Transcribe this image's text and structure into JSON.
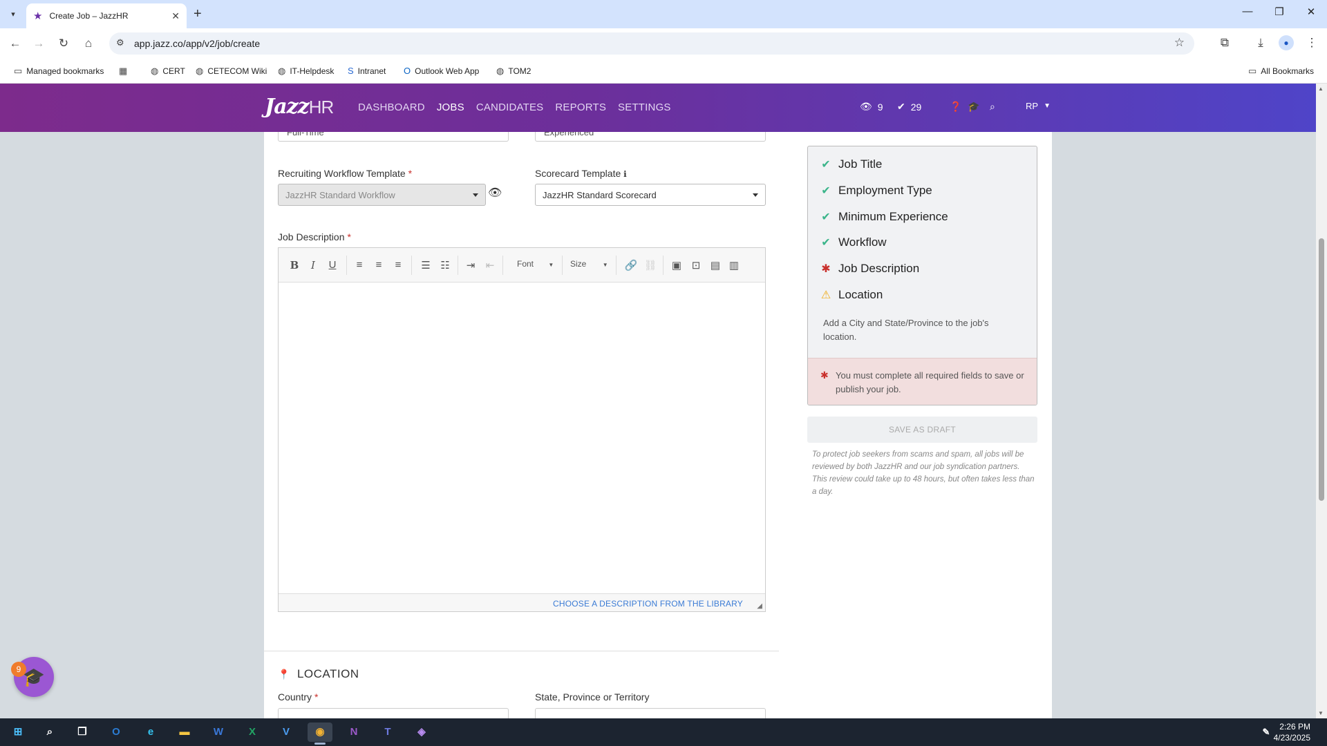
{
  "browser": {
    "tab_title": "Create Job – JazzHR",
    "url": "app.jazz.co/app/v2/job/create",
    "bookmarks": [
      "Managed bookmarks",
      "CERT",
      "CETECOM Wiki",
      "IT-Helpdesk",
      "Intranet",
      "Outlook Web App",
      "TOM2"
    ],
    "all_bookmarks": "All Bookmarks"
  },
  "nav": {
    "logo_jazz": "Jazz",
    "logo_hr": "HR",
    "items": [
      "DASHBOARD",
      "JOBS",
      "CANDIDATES",
      "REPORTS",
      "SETTINGS"
    ],
    "active": "JOBS",
    "views_count": "9",
    "checks_count": "29",
    "user_initials": "RP"
  },
  "form": {
    "employment_type_value": "Full-Time",
    "experience_value": "Experienced",
    "workflow_label": "Recruiting Workflow Template",
    "workflow_value": "JazzHR Standard Workflow",
    "scorecard_label": "Scorecard Template",
    "scorecard_value": "JazzHR Standard Scorecard",
    "description_label": "Job Description",
    "editor_font": "Font",
    "editor_size": "Size",
    "library_link": "CHOOSE A DESCRIPTION FROM THE LIBRARY",
    "location_section": "LOCATION",
    "country_label": "Country",
    "state_label": "State, Province or Territory"
  },
  "checklist": {
    "items": [
      {
        "label": "Job Title",
        "status": "ok"
      },
      {
        "label": "Employment Type",
        "status": "ok"
      },
      {
        "label": "Minimum Experience",
        "status": "ok"
      },
      {
        "label": "Workflow",
        "status": "ok"
      },
      {
        "label": "Job Description",
        "status": "missing"
      },
      {
        "label": "Location",
        "status": "warning"
      }
    ],
    "location_note": "Add a City and State/Province to the job's location.",
    "error_message": "You must complete all required fields to save or publish your job.",
    "save_draft": "SAVE AS DRAFT",
    "disclaimer": "To protect job seekers from scams and spam, all jobs will be reviewed by both JazzHR and our job syndication partners. This review could take up to 48 hours, but often takes less than a day."
  },
  "help_widget": {
    "count": "9"
  },
  "taskbar": {
    "time": "2:26 PM",
    "date": "4/23/2025"
  },
  "colors": {
    "nav_start": "#7d2b8c",
    "nav_end": "#4f44c8",
    "ok": "#3bb58a",
    "error": "#c9302c",
    "warning": "#f0ad1c"
  }
}
